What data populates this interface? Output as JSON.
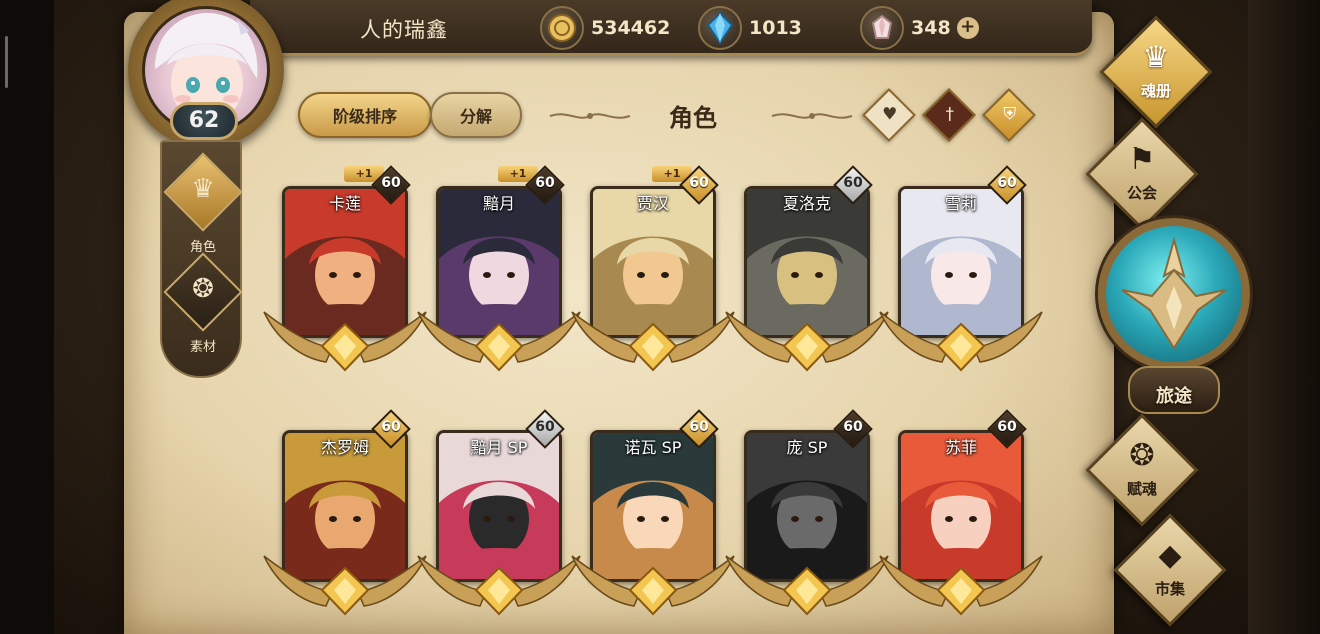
{
  "header": {
    "player_name": "人的瑞鑫",
    "gold": "534462",
    "crystal": "1013",
    "gem": "348",
    "gem_plus": "+"
  },
  "player": {
    "level": "62"
  },
  "side_nav": [
    {
      "label": "角色",
      "icon": "helmet-icon",
      "selected": true
    },
    {
      "label": "素材",
      "icon": "beast-icon",
      "selected": false
    }
  ],
  "toolbar": {
    "sort_label": "阶级排序",
    "disassemble_label": "分解",
    "title": "角色",
    "filters": [
      "heart-icon",
      "sword-icon",
      "shield-icon"
    ]
  },
  "characters": [
    {
      "name": "卡莲",
      "level": "60",
      "badge": "+1",
      "level_style": "dark",
      "colors": [
        "#c83a2a",
        "#6a2a20",
        "#f0b080"
      ]
    },
    {
      "name": "黯月",
      "level": "60",
      "badge": "+1",
      "level_style": "dark",
      "colors": [
        "#2a2a3a",
        "#5a3a6a",
        "#f0d8e0"
      ]
    },
    {
      "name": "贾汉",
      "level": "60",
      "badge": "+1",
      "level_style": "gold",
      "colors": [
        "#e8d8a8",
        "#a88a50",
        "#f0c890"
      ]
    },
    {
      "name": "夏洛克",
      "level": "60",
      "badge": "",
      "level_style": "silver",
      "colors": [
        "#3a3a36",
        "#6a6a60",
        "#d8c080"
      ]
    },
    {
      "name": "雪莉",
      "level": "60",
      "badge": "",
      "level_style": "gold",
      "colors": [
        "#e8e8f0",
        "#b0b8d0",
        "#f8e8e8"
      ]
    },
    {
      "name": "杰罗姆",
      "level": "60",
      "badge": "",
      "level_style": "gold",
      "colors": [
        "#c89a3a",
        "#7a2a1a",
        "#e8a870"
      ]
    },
    {
      "name": "黯月 SP",
      "level": "60",
      "badge": "",
      "level_style": "silver",
      "colors": [
        "#e8d8d8",
        "#c83a5a",
        "#2a2a2a"
      ]
    },
    {
      "name": "诺瓦 SP",
      "level": "60",
      "badge": "",
      "level_style": "gold",
      "colors": [
        "#2a3a3a",
        "#c88a4a",
        "#f8d8b8"
      ]
    },
    {
      "name": "庞 SP",
      "level": "60",
      "badge": "",
      "level_style": "dark",
      "colors": [
        "#3a3a3a",
        "#1a1a1a",
        "#6a6a6a"
      ]
    },
    {
      "name": "苏菲",
      "level": "60",
      "badge": "",
      "level_style": "dark",
      "colors": [
        "#e85a3a",
        "#c83a2a",
        "#f8d0c0"
      ]
    }
  ],
  "right_nav": [
    {
      "label": "魂册",
      "icon": "helmet-icon"
    },
    {
      "label": "公会",
      "icon": "banner-icon"
    },
    {
      "label": "旅途",
      "icon": "compass-icon"
    },
    {
      "label": "赋魂",
      "icon": "flame-icon"
    },
    {
      "label": "市集",
      "icon": "gem-icon"
    }
  ]
}
